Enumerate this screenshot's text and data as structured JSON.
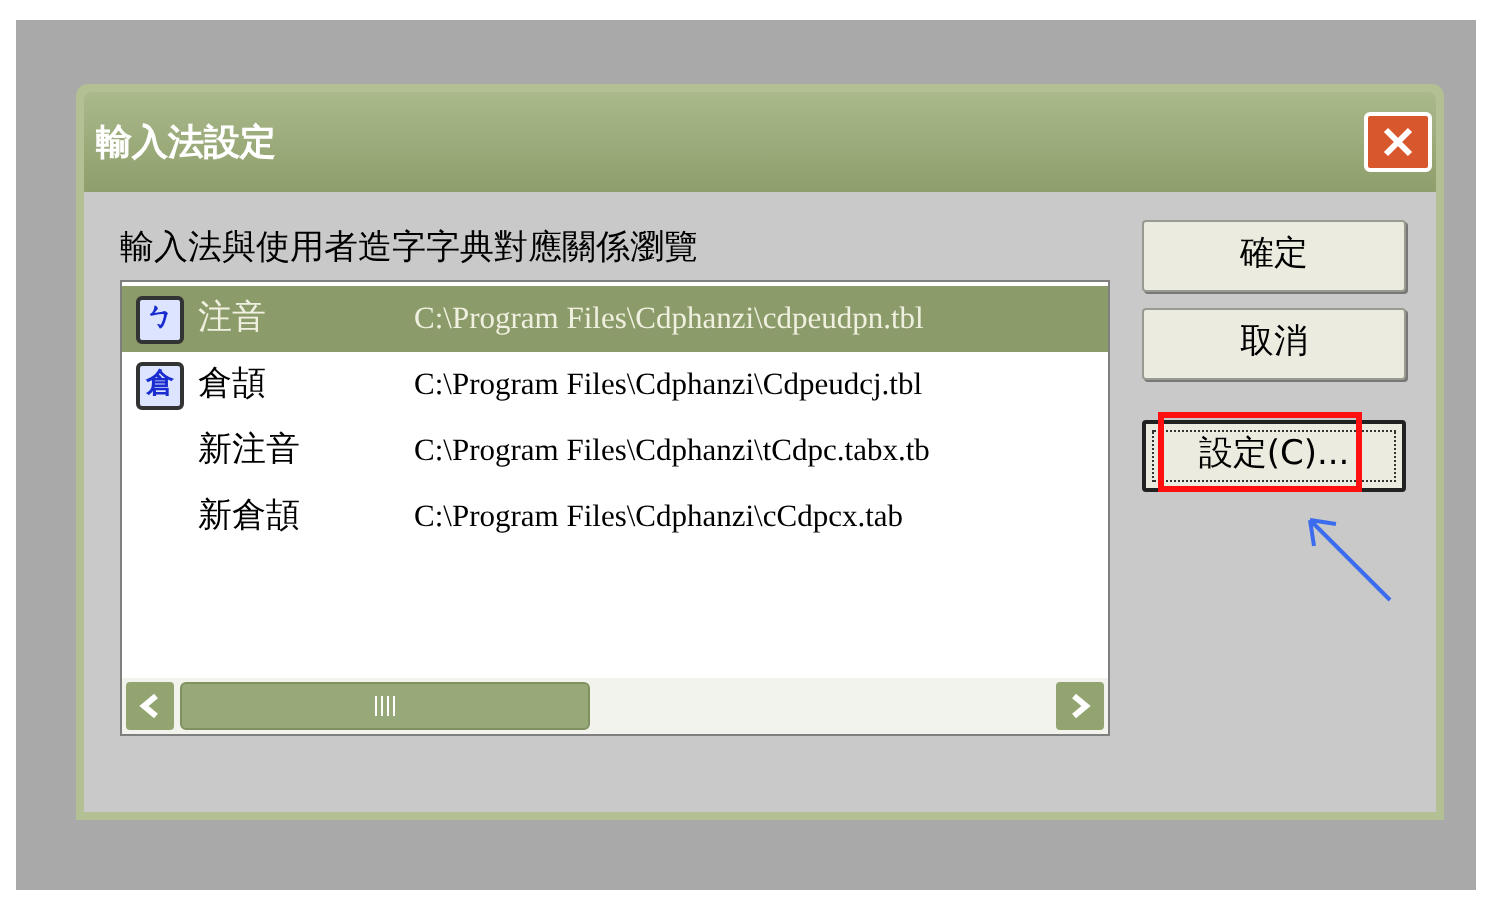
{
  "window": {
    "title": "輸入法設定"
  },
  "list_label": "輸入法與使用者造字字典對應關係瀏覽",
  "rows": [
    {
      "icon_glyph": "ㄅ",
      "name": "注音",
      "path": "C:\\Program Files\\Cdphanzi\\cdpeudpn.tbl",
      "selected": true
    },
    {
      "icon_glyph": "倉",
      "name": "倉頡",
      "path": "C:\\Program Files\\Cdphanzi\\Cdpeudcj.tbl",
      "selected": false
    },
    {
      "name": "新注音",
      "path": "C:\\Program Files\\Cdphanzi\\tCdpc.tabx.tb",
      "selected": false
    },
    {
      "name": "新倉頡",
      "path": "C:\\Program Files\\Cdphanzi\\cCdpcx.tab",
      "selected": false
    }
  ],
  "buttons": [
    {
      "label": "確定",
      "focused": false,
      "highlighted": false
    },
    {
      "label": "取消",
      "focused": false,
      "highlighted": false
    },
    {
      "label": "設定(C)...",
      "focused": true,
      "highlighted": true
    }
  ]
}
